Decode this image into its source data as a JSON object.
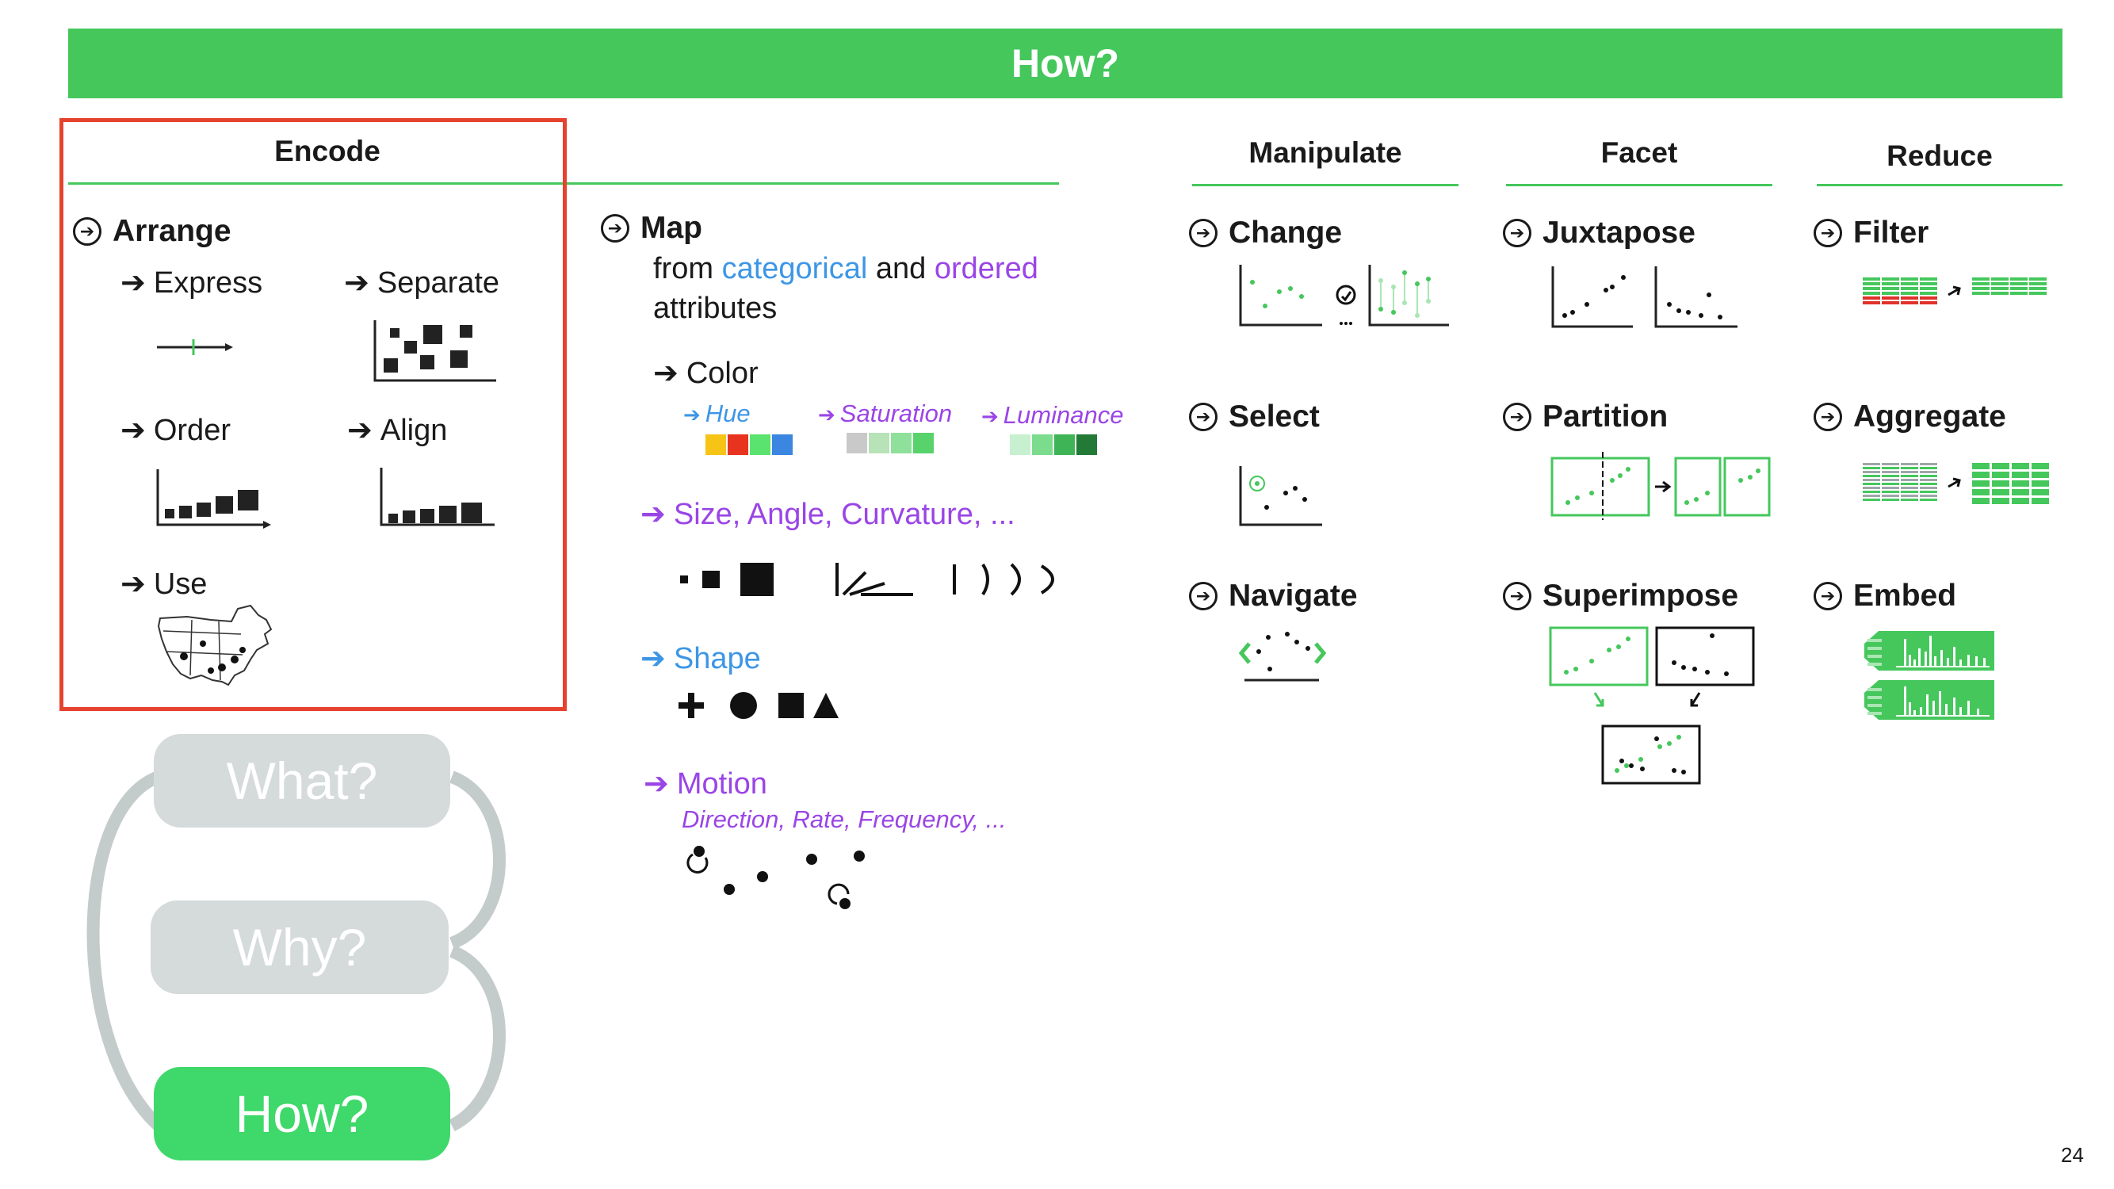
{
  "banner": "How?",
  "encode": {
    "header": "Encode",
    "arrange": "Arrange",
    "express": "Express",
    "separate": "Separate",
    "order": "Order",
    "align": "Align",
    "use": "Use"
  },
  "map": {
    "title": "Map",
    "line1_from": "from",
    "line1_categorical": "categorical",
    "line1_and": "and",
    "line1_ordered": "ordered",
    "line2": "attributes",
    "color": "Color",
    "hue": "Hue",
    "saturation": "Saturation",
    "luminance": "Luminance",
    "hue_colors": [
      "#f6c416",
      "#e8331f",
      "#5ae36e",
      "#3a86e0"
    ],
    "sat_colors": [
      "#c9c9c9",
      "#b8e2b8",
      "#8ee09a",
      "#58d26b"
    ],
    "lum_colors": [
      "#c6f0cf",
      "#7bdc8d",
      "#3fb457",
      "#237a37"
    ],
    "size": "Size, Angle, Curvature, ...",
    "shape": "Shape",
    "motion": "Motion",
    "motion_sub": "Direction, Rate, Frequency, ..."
  },
  "manipulate": {
    "header": "Manipulate",
    "change": "Change",
    "select": "Select",
    "navigate": "Navigate"
  },
  "facet": {
    "header": "Facet",
    "juxtapose": "Juxtapose",
    "partition": "Partition",
    "superimpose": "Superimpose"
  },
  "reduce": {
    "header": "Reduce",
    "filter": "Filter",
    "aggregate": "Aggregate",
    "embed": "Embed"
  },
  "nav": {
    "what": "What?",
    "why": "Why?",
    "how": "How?"
  },
  "colors": {
    "green": "#45c75c",
    "highlight_box": "#e5432f",
    "pill_gray": "#d5dada",
    "pill_green": "#3fd86a",
    "loop_gray": "#c4cbcb"
  },
  "page_number": "24"
}
